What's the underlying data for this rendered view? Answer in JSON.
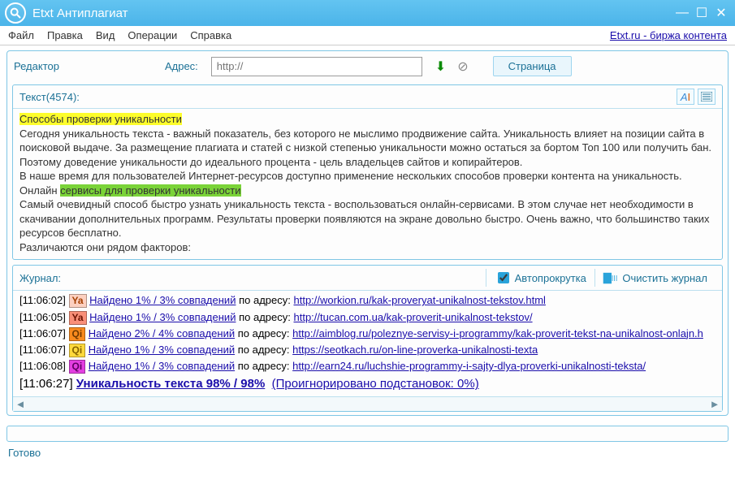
{
  "window": {
    "title": "Etxt Антиплагиат"
  },
  "menu": {
    "items": [
      "Файл",
      "Правка",
      "Вид",
      "Операции",
      "Справка"
    ],
    "right_link": "Etxt.ru - биржа контента"
  },
  "tabs": {
    "editor": "Редактор",
    "address_label": "Адрес:",
    "address_placeholder": "http://",
    "page_tab": "Страница"
  },
  "text_panel": {
    "header": "Текст(4574):",
    "hl1": "Способы проверки уникальности",
    "p1a": "Сегодня уникальность текста - важный показатель, без которого не мыслимо продвижение сайта. Уникальность влияет на позиции сайта в поисковой выдаче. За размещение плагиата и статей с низкой степенью уникальности можно остаться за бортом Топ 100 или получить бан. Поэтому доведение уникальности до идеального процента - цель владельцев сайтов и копирайтеров.",
    "p1b": "В наше время для пользователей Интернет-ресурсов доступно применение нескольких способов проверки контента на уникальность.",
    "p2a_pre": "Онлайн ",
    "hl2": "сервисы для проверки уникальности",
    "p2b": "Самый очевидный способ быстро узнать уникальность текста - воспользоваться онлайн-сервисами. В этом случае нет необходимости в скачивании дополнительных программ. Результаты проверки появляются на экране довольно быстро. Очень важно, что большинство таких ресурсов бесплатно.",
    "p2c": "Различаются они рядом факторов:"
  },
  "journal": {
    "title": "Журнал:",
    "autoscroll_label": "Автопрокрутка",
    "clear_label": "Очистить журнал",
    "lines": [
      {
        "time": "[11:06:02]",
        "tag_text": "Ya",
        "tag_class": "tag-ya1",
        "match": "Найдено 1% / 3% совпадений",
        "addr": "по адресу:",
        "url": "http://workion.ru/kak-proveryat-unikalnost-tekstov.html"
      },
      {
        "time": "[11:06:05]",
        "tag_text": "Ya",
        "tag_class": "tag-ya2",
        "match": "Найдено 1% / 3% совпадений",
        "addr": "по адресу:",
        "url": "http://tucan.com.ua/kak-proverit-unikalnost-tekstov/"
      },
      {
        "time": "[11:06:07]",
        "tag_text": "Qi",
        "tag_class": "tag-qi1",
        "match": "Найдено 2% / 4% совпадений",
        "addr": "по адресу:",
        "url": "http://aimblog.ru/poleznye-servisy-i-programmy/kak-proverit-tekst-na-unikalnost-onlajn.h"
      },
      {
        "time": "[11:06:07]",
        "tag_text": "Qi",
        "tag_class": "tag-qi2",
        "match": "Найдено 1% / 3% совпадений",
        "addr": "по адресу:",
        "url": "https://seotkach.ru/on-line-proverka-unikalnosti-texta"
      },
      {
        "time": "[11:06:08]",
        "tag_text": "Qi",
        "tag_class": "tag-qi3",
        "match": "Найдено 1% / 3% совпадений",
        "addr": "по адресу:",
        "url": "http://earn24.ru/luchshie-programmy-i-sajty-dlya-proverki-unikalnosti-teksta/"
      }
    ],
    "final_time": "[11:06:27]",
    "final_bold": "Уникальность текста 98% / 98%",
    "final_rest": "(Проигнорировано подстановок: 0%)"
  },
  "status": "Готово"
}
